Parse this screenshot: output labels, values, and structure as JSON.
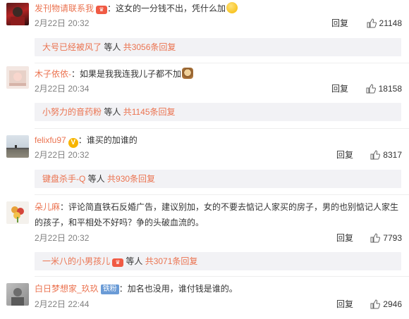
{
  "comments": [
    {
      "user": "发刊物请联系我",
      "text": "：这女的一分钱不出，凭什么加",
      "time": "2月22日 20:32",
      "reply_label": "回复",
      "likes": "21148",
      "sub": {
        "user": "大号已经被风了",
        "mid": " 等人 ",
        "more": "共3056条回复"
      }
    },
    {
      "user": "木子依依-",
      "text": "：如果是我我连我儿子都不加",
      "time": "2月22日 20:34",
      "reply_label": "回复",
      "likes": "18158",
      "sub": {
        "user": "小努力的音药粉",
        "mid": " 等人 ",
        "more": "共1145条回复"
      }
    },
    {
      "user": "felixfu97",
      "text": "：谁买的加谁的",
      "time": "2月22日 20:32",
      "reply_label": "回复",
      "likes": "8317",
      "sub": {
        "user": "键盘杀手-Q",
        "mid": " 等人 ",
        "more": "共930条回复"
      }
    },
    {
      "user": "朵儿麻",
      "text": "：评论简直铁石反婚广告，建议别加，女的不要去惦记人家买的房子，男的也别惦记人家生",
      "text2": "的孩子，和平相处不好吗？争的头破血流的。",
      "time": "2月22日 20:32",
      "reply_label": "回复",
      "likes": "7793",
      "sub": {
        "user": "一米八的小男孩儿",
        "mid": " 等人 ",
        "more": "共3071条回复"
      }
    },
    {
      "user": "白日梦想家_玖玖",
      "badge": "铁粉",
      "text": "：加名也没用，谁付钱是谁的。",
      "time": "2月22日 22:44",
      "reply_label": "回复",
      "likes": "2946"
    }
  ]
}
